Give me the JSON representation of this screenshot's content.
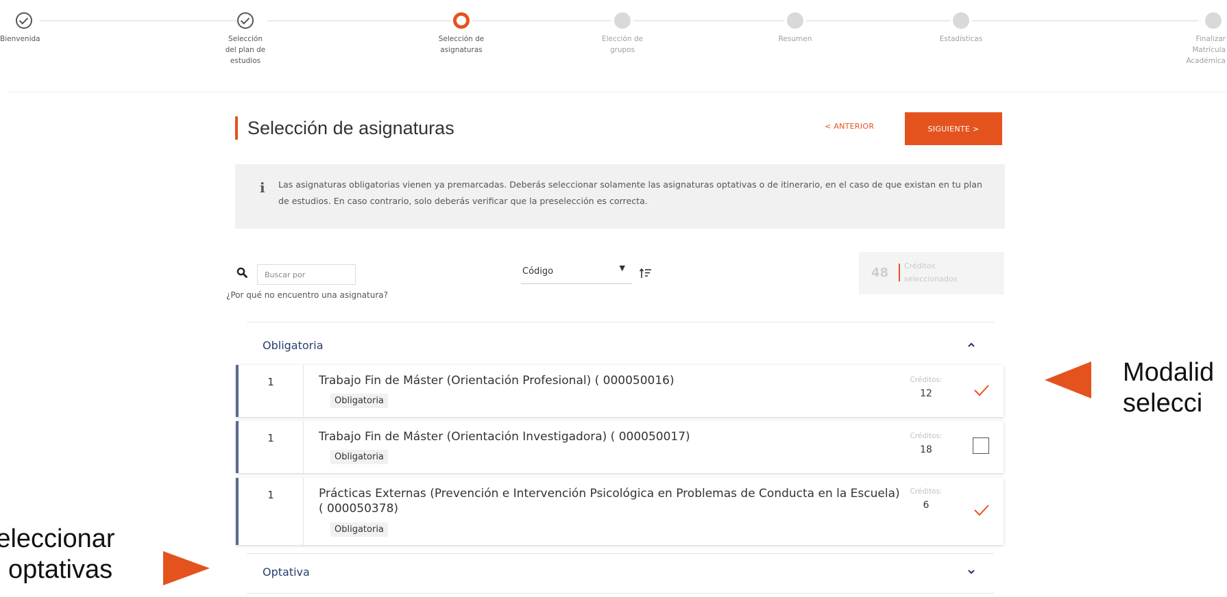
{
  "stepper": {
    "steps": [
      {
        "label": "Bienvenida",
        "status": "done"
      },
      {
        "label": "Selección del plan de estudios",
        "status": "done"
      },
      {
        "label": "Selección de asignaturas",
        "status": "active"
      },
      {
        "label": "Elección de grupos",
        "status": "pending"
      },
      {
        "label": "Resumen",
        "status": "pending"
      },
      {
        "label": "Estadísticas",
        "status": "pending"
      },
      {
        "label": "Finalizar Matrícula Académica",
        "status": "pending"
      }
    ]
  },
  "header": {
    "title": "Selección de asignaturas",
    "prev_label": "< ANTERIOR",
    "next_label": "SIGUIENTE >"
  },
  "info": {
    "icon": "info-icon",
    "text": "Las asignaturas obligatorias vienen ya premarcadas. Deberás seleccionar solamente las asignaturas optativas o de itinerario, en el caso de que existan en tu plan de estudios. En caso contrario, solo deberás verificar que la preselección es correcta."
  },
  "toolbar": {
    "search_placeholder": "Buscar por",
    "help_link": "¿Por qué no encuentro una asignatura?",
    "sort_value": "Código",
    "credits_count": "48",
    "credits_label_1": "Créditos",
    "credits_label_2": "seleccionados"
  },
  "groups": [
    {
      "title": "Obligatoria",
      "expanded": true,
      "rows": [
        {
          "num": "1",
          "name": "Trabajo Fin de Máster (Orientación Profesional) ( 000050016)",
          "tag": "Obligatoria",
          "credits_label": "Créditos:",
          "credits": "12",
          "selected": true
        },
        {
          "num": "1",
          "name": "Trabajo Fin de Máster (Orientación Investigadora) ( 000050017)",
          "tag": "Obligatoria",
          "credits_label": "Créditos:",
          "credits": "18",
          "selected": false
        },
        {
          "num": "1",
          "name": "Prácticas Externas (Prevención e Intervención Psicológica en Problemas de Conducta en la Escuela) ( 000050378)",
          "tag": "Obligatoria",
          "credits_label": "Créditos:",
          "credits": "6",
          "selected": true
        }
      ]
    },
    {
      "title": "Optativa",
      "expanded": false,
      "rows": []
    }
  ],
  "annotations": {
    "right_line_1": "Modalid",
    "right_line_2": "selecci",
    "left_line_1": "Seleccionar",
    "left_line_2": "optativas",
    "accent": "#e4531e"
  },
  "colors": {
    "accent": "#e4531e",
    "group_title": "#2a3d6e",
    "row_border": "#5a6994"
  }
}
